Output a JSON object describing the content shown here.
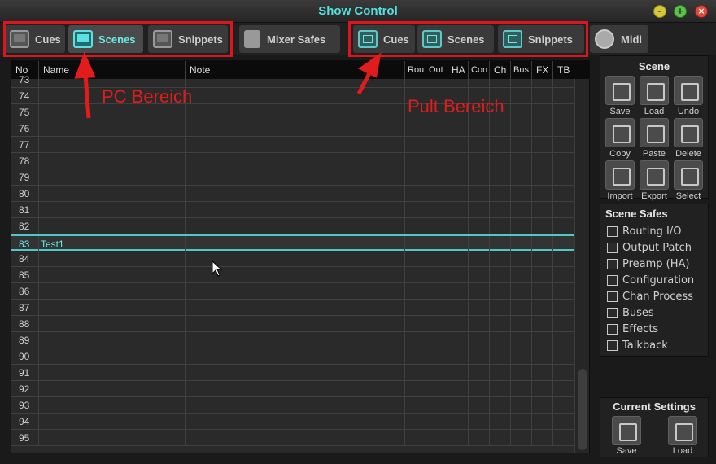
{
  "window": {
    "title": "Show Control"
  },
  "tabs": [
    {
      "label": "Cues",
      "icon": "monitor-icon"
    },
    {
      "label": "Scenes",
      "icon": "monitor-icon",
      "active": true
    },
    {
      "label": "Snippets",
      "icon": "monitor-icon"
    },
    {
      "label": "Mixer Safes",
      "icon": "lock-icon"
    },
    {
      "label": "Cues",
      "icon": "console-cues-icon"
    },
    {
      "label": "Scenes",
      "icon": "console-scenes-icon"
    },
    {
      "label": "Snippets",
      "icon": "console-snippets-icon"
    },
    {
      "label": "Midi",
      "icon": "midi-icon"
    }
  ],
  "annotations": {
    "pc": "PC Bereich",
    "pult": "Pult Bereich"
  },
  "table": {
    "headers": [
      "No",
      "Name",
      "Note",
      "Rou",
      "Out",
      "HA",
      "Con",
      "Ch",
      "Bus",
      "FX",
      "TB"
    ],
    "rows": [
      {
        "no": "73",
        "name": ""
      },
      {
        "no": "74",
        "name": ""
      },
      {
        "no": "75",
        "name": ""
      },
      {
        "no": "76",
        "name": ""
      },
      {
        "no": "77",
        "name": ""
      },
      {
        "no": "78",
        "name": ""
      },
      {
        "no": "79",
        "name": ""
      },
      {
        "no": "80",
        "name": ""
      },
      {
        "no": "81",
        "name": ""
      },
      {
        "no": "82",
        "name": ""
      },
      {
        "no": "83",
        "name": "Test1",
        "selected": true
      },
      {
        "no": "84",
        "name": ""
      },
      {
        "no": "85",
        "name": ""
      },
      {
        "no": "86",
        "name": ""
      },
      {
        "no": "87",
        "name": ""
      },
      {
        "no": "88",
        "name": ""
      },
      {
        "no": "89",
        "name": ""
      },
      {
        "no": "90",
        "name": ""
      },
      {
        "no": "91",
        "name": ""
      },
      {
        "no": "92",
        "name": ""
      },
      {
        "no": "93",
        "name": ""
      },
      {
        "no": "94",
        "name": ""
      },
      {
        "no": "95",
        "name": ""
      }
    ]
  },
  "scene_panel": {
    "title": "Scene",
    "buttons": [
      "Save",
      "Load",
      "Undo",
      "Copy",
      "Paste",
      "Delete",
      "Import",
      "Export",
      "Select"
    ]
  },
  "scene_safes": {
    "title": "Scene Safes",
    "items": [
      "Routing I/O",
      "Output Patch",
      "Preamp (HA)",
      "Configuration",
      "Chan Process",
      "Buses",
      "Effects",
      "Talkback"
    ]
  },
  "current_settings": {
    "title": "Current Settings",
    "buttons": [
      "Save",
      "Load"
    ]
  }
}
